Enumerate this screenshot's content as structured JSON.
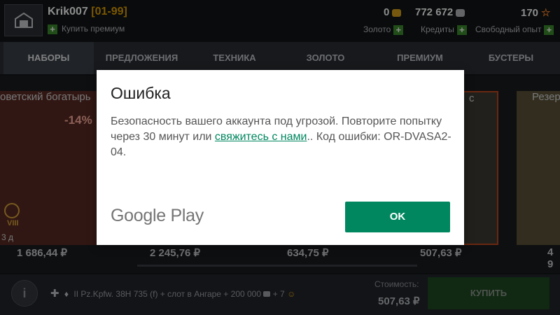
{
  "header": {
    "player_name": "Krik007",
    "player_range": "[01-99]",
    "buy_premium": "Купить премиум",
    "gold": {
      "value": "0",
      "label": "Золото"
    },
    "credits": {
      "value": "772 672",
      "label": "Кредиты"
    },
    "free_xp": {
      "value": "170",
      "label": "Свободный опыт"
    },
    "colors": {
      "gold": "#d8a21d",
      "credits": "#b6b8ba",
      "free_xp": "#e87b2a",
      "plus": "#3c8d2f"
    }
  },
  "tabs": [
    {
      "label": "НАБОРЫ",
      "active": true
    },
    {
      "label": "ПРЕДЛОЖЕНИЯ"
    },
    {
      "label": "ТЕХНИКА"
    },
    {
      "label": "ЗОЛОТО"
    },
    {
      "label": "ПРЕМИУМ"
    },
    {
      "label": "БУСТЕРЫ"
    }
  ],
  "store": {
    "cards": [
      {
        "title": "оветский богатырь",
        "discount": "-14%",
        "tier": "VIII",
        "duration": "3 д",
        "price": "1 686,44 ₽"
      },
      {
        "price": "2 245,76 ₽"
      },
      {
        "price": "634,75 ₽"
      },
      {
        "title": "с",
        "price": "507,63 ₽"
      },
      {
        "title": "Резер",
        "price": "4 9"
      }
    ]
  },
  "bottom": {
    "description": "II Pz.Kpfw. 38H 735 (f) + слот в Ангаре + 200 000",
    "description_extra": "+ 7",
    "cost_label": "Стоимость:",
    "cost_value": "507,63 ₽",
    "buy_label": "КУПИТЬ"
  },
  "dialog": {
    "title": "Ошибка",
    "body_before": "Безопасность вашего аккаунта под угрозой. Повторите попытку через 30 минут или ",
    "body_link": "свяжитесь с нами",
    "body_after": ".. Код ошибки: OR-DVASA2-04.",
    "brand": "Google Play",
    "ok_label": "OK",
    "accent_color": "#01875f"
  }
}
